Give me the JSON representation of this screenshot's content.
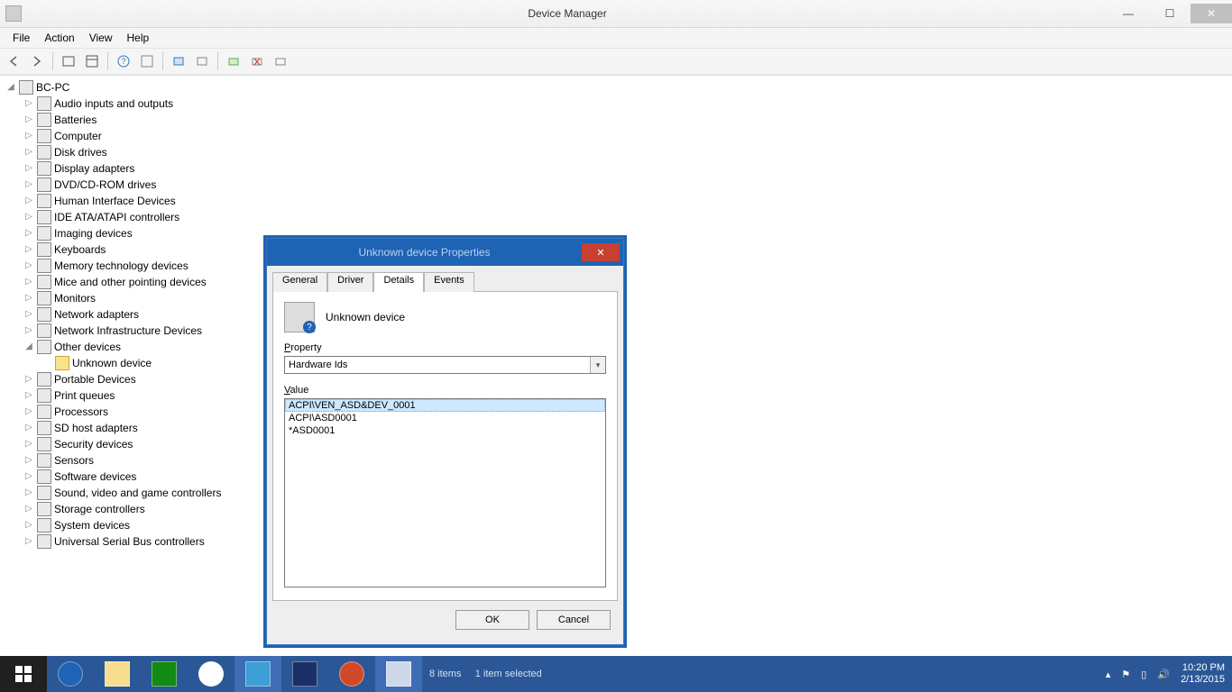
{
  "window": {
    "title": "Device Manager"
  },
  "menu": {
    "file": "File",
    "action": "Action",
    "view": "View",
    "help": "Help"
  },
  "tree": {
    "root": "BC-PC",
    "items": [
      "Audio inputs and outputs",
      "Batteries",
      "Computer",
      "Disk drives",
      "Display adapters",
      "DVD/CD-ROM drives",
      "Human Interface Devices",
      "IDE ATA/ATAPI controllers",
      "Imaging devices",
      "Keyboards",
      "Memory technology devices",
      "Mice and other pointing devices",
      "Monitors",
      "Network adapters",
      "Network Infrastructure Devices",
      "Other devices",
      "Portable Devices",
      "Print queues",
      "Processors",
      "SD host adapters",
      "Security devices",
      "Sensors",
      "Software devices",
      "Sound, video and game controllers",
      "Storage controllers",
      "System devices",
      "Universal Serial Bus controllers"
    ],
    "other_child": "Unknown device"
  },
  "dialog": {
    "title": "Unknown device Properties",
    "tabs": {
      "general": "General",
      "driver": "Driver",
      "details": "Details",
      "events": "Events"
    },
    "device_name": "Unknown device",
    "property_label": "Property",
    "property_value": "Hardware Ids",
    "value_label": "Value",
    "values": [
      "ACPI\\VEN_ASD&DEV_0001",
      "ACPI\\ASD0001",
      "*ASD0001"
    ],
    "ok": "OK",
    "cancel": "Cancel"
  },
  "taskbar": {
    "status_items": "8 items",
    "status_selected": "1 item selected",
    "time": "10:20 PM",
    "date": "2/13/2015"
  }
}
